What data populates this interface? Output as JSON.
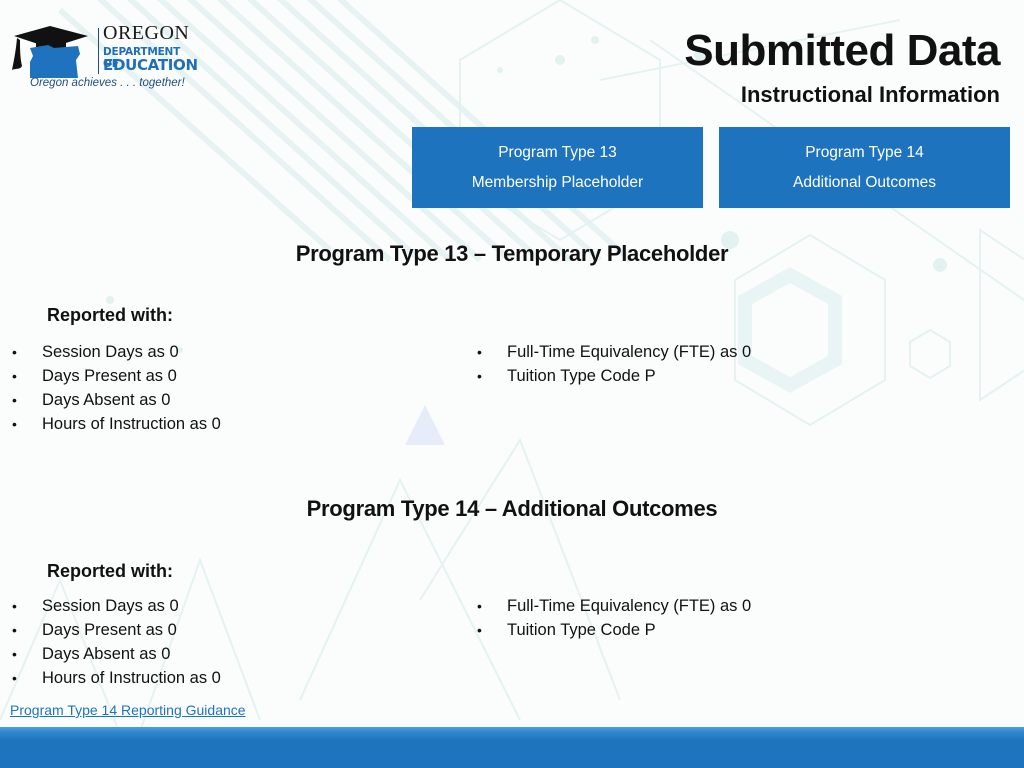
{
  "logo": {
    "icon": "oregon-graduation-cap-icon",
    "name_line1": "OREGON",
    "name_line2": "DEPARTMENT OF",
    "name_line3": "EDUCATION",
    "tagline": "Oregon achieves . . . together!"
  },
  "header": {
    "title": "Submitted Data",
    "subtitle": "Instructional Information"
  },
  "program_buttons": [
    {
      "line1": "Program Type 13",
      "line2": "Membership Placeholder"
    },
    {
      "line1": "Program Type 14",
      "line2": "Additional Outcomes"
    }
  ],
  "sections": [
    {
      "heading": "Program Type 13 – Temporary Placeholder",
      "reported_label": "Reported with:",
      "left_items": [
        "Session Days as 0",
        "Days Present as 0",
        "Days Absent as 0",
        "Hours of Instruction as 0"
      ],
      "right_items": [
        "Full-Time Equivalency (FTE) as 0",
        "Tuition Type Code P"
      ]
    },
    {
      "heading": "Program Type 14 – Additional Outcomes",
      "reported_label": "Reported with:",
      "left_items": [
        "Session Days as 0",
        "Days Present as 0",
        "Days Absent as 0",
        "Hours of Instruction as 0"
      ],
      "right_items": [
        "Full-Time Equivalency (FTE) as 0",
        "Tuition Type Code P"
      ]
    }
  ],
  "bullet_glyph": "•",
  "guidance_link": "Program Type 14 Reporting Guidance",
  "colors": {
    "brand_blue": "#1e73be",
    "footer_highlight": "#4aa0e0",
    "logo_navy": "#1f4e79"
  }
}
